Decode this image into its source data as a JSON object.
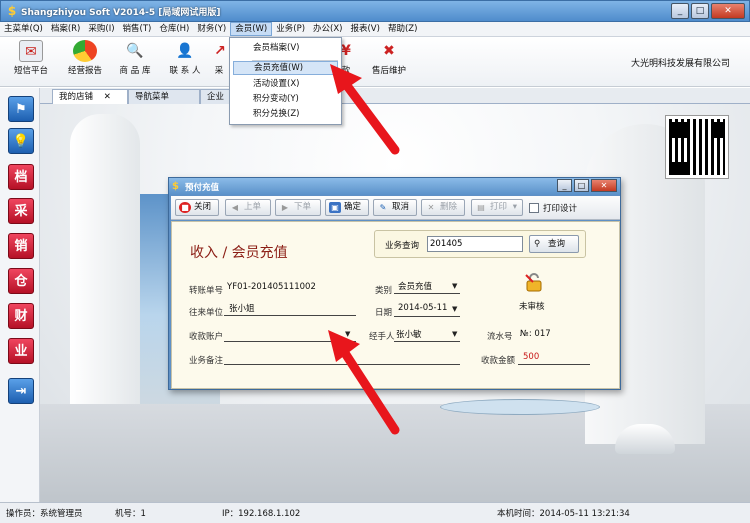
{
  "window": {
    "title": "Shangzhiyou Soft V2014-5 [局域网试用版]",
    "min": "_",
    "max": "□",
    "close": "✕"
  },
  "menubar": {
    "items": [
      {
        "label": "主菜单(Q)"
      },
      {
        "label": "档案(R)"
      },
      {
        "label": "采购(I)"
      },
      {
        "label": "销售(T)"
      },
      {
        "label": "仓库(H)"
      },
      {
        "label": "财务(Y)"
      },
      {
        "label": "会员(W)"
      },
      {
        "label": "业务(P)"
      },
      {
        "label": "办公(X)"
      },
      {
        "label": "报表(V)"
      },
      {
        "label": "帮助(Z)"
      }
    ]
  },
  "toolbar": {
    "items": [
      {
        "label": "短信平台",
        "icon": "envelope-icon"
      },
      {
        "label": "经营报告",
        "icon": "pie-chart-icon"
      },
      {
        "label": "商 品 库",
        "icon": "magnifier-icon"
      },
      {
        "label": "联 系 人",
        "icon": "person-icon"
      },
      {
        "label": "采",
        "icon": "purchase-icon"
      },
      {
        "label": "款",
        "icon": "money-icon"
      },
      {
        "label": "售后维护",
        "icon": "tools-icon"
      }
    ],
    "company": "大光明科技发展有限公司"
  },
  "member_menu": {
    "items": [
      {
        "label": "会员档案(V)"
      },
      {
        "label": "会员充值(W)"
      },
      {
        "label": "活动设置(X)"
      },
      {
        "label": "积分变动(Y)"
      },
      {
        "label": "积分兑换(Z)"
      }
    ]
  },
  "tabs": {
    "items": [
      {
        "label": "我的店铺",
        "close": "✕"
      },
      {
        "label": "导航菜单"
      },
      {
        "label": "企业"
      }
    ]
  },
  "sidebar": {
    "items": [
      {
        "label": "⚑",
        "icon": "flag-icon"
      },
      {
        "label": "💡",
        "icon": "bulb-icon"
      },
      {
        "label": "档",
        "icon": "archive-icon"
      },
      {
        "label": "采",
        "icon": "purchase-icon"
      },
      {
        "label": "销",
        "icon": "sales-icon"
      },
      {
        "label": "仓",
        "icon": "warehouse-icon"
      },
      {
        "label": "财",
        "icon": "finance-icon"
      },
      {
        "label": "业",
        "icon": "business-icon"
      },
      {
        "label": "⇥",
        "icon": "exit-icon"
      }
    ]
  },
  "dialog": {
    "title": "预付充值",
    "toolbar": {
      "close": "关闭",
      "prev": "上单",
      "next": "下单",
      "confirm": "确定",
      "cancel": "取消",
      "delete": "删除",
      "print": "打印",
      "print_design": "打印设计"
    },
    "form_title": "收入 / 会员充值",
    "search": {
      "label": "业务查询",
      "value": "201405",
      "button": "查询"
    },
    "fields": {
      "voucher_no_label": "转账单号",
      "voucher_no": "YF01-201405111002",
      "category_label": "类别",
      "category": "会员充值",
      "unit_label": "往来单位",
      "unit": "张小姐",
      "date_label": "日期",
      "date": "2014-05-11",
      "account_label": "收款账户",
      "account": "",
      "handler_label": "经手人",
      "handler": "张小敏",
      "serial_label": "流水号",
      "serial": "№: 017",
      "remark_label": "业务备注",
      "remark": "",
      "amount_label": "收款金额",
      "amount": "500",
      "status": "未审核"
    }
  },
  "statusbar": {
    "operator": "操作员：系统管理员",
    "machine": "机号：1",
    "ip": "IP：192.168.1.102",
    "time": "本机时间：2014-05-11 13:21:34"
  }
}
